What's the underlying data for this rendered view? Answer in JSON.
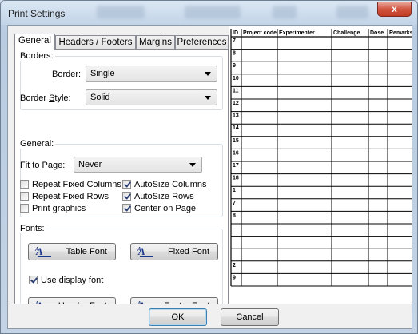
{
  "window": {
    "title": "Print Settings",
    "close_glyph": "x"
  },
  "tabs": [
    {
      "label": "General",
      "active": true
    },
    {
      "label": "Headers / Footers",
      "active": false
    },
    {
      "label": "Margins",
      "active": false
    },
    {
      "label": "Preferences",
      "active": false
    }
  ],
  "borders": {
    "group_label": "Borders:",
    "border_label_u": "B",
    "border_label_rest": "order:",
    "border_value": "Single",
    "style_label_pre": "Border ",
    "style_label_u": "S",
    "style_label_rest": "tyle:",
    "style_value": "Solid"
  },
  "general": {
    "group_label": "General:",
    "fit_label_pre": "Fit to ",
    "fit_label_u": "P",
    "fit_label_rest": "age:",
    "fit_value": "Never",
    "checks": [
      {
        "label": "Repeat Fixed Columns",
        "checked": false
      },
      {
        "label": "AutoSize Columns",
        "checked": true
      },
      {
        "label": "Repeat Fixed Rows",
        "checked": false
      },
      {
        "label": "AutoSize Rows",
        "checked": true
      },
      {
        "label": "Print graphics",
        "checked": false
      },
      {
        "label": "Center on Page",
        "checked": true
      }
    ]
  },
  "fonts": {
    "group_label": "Fonts:",
    "table_font": "Table Font",
    "fixed_font": "Fixed Font",
    "use_display_font": "Use display font",
    "use_display_checked": true,
    "header_font": "Header Font",
    "footer_font": "Footer Font",
    "icon_text": "A",
    "icon_sup": "A"
  },
  "preview": {
    "columns": [
      "ID",
      "Project code",
      "Experimenter",
      "Challenge",
      "Dose",
      "Remarks"
    ],
    "row_labels": [
      "7",
      "8",
      "9",
      "10",
      "11",
      "12",
      "13",
      "14",
      "15",
      "16",
      "17",
      "18",
      "1",
      "7",
      "8",
      "",
      "",
      "",
      "2",
      "9"
    ]
  },
  "footer": {
    "ok": "OK",
    "cancel": "Cancel"
  }
}
